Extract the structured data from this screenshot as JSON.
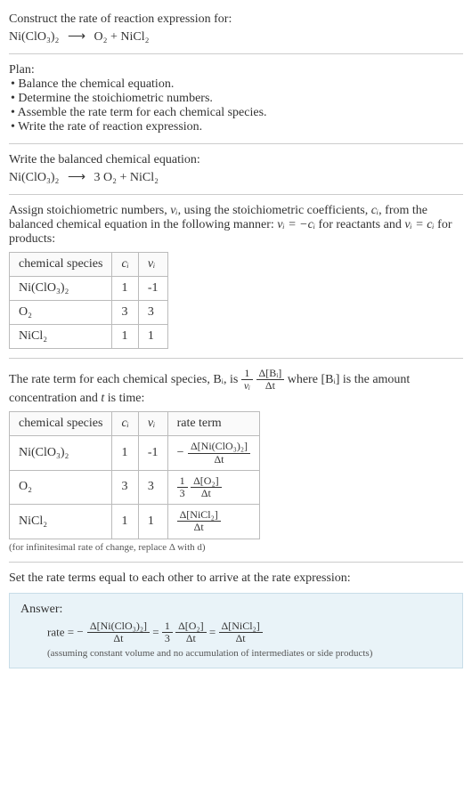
{
  "prompt": {
    "title": "Construct the rate of reaction expression for:",
    "reactant": "Ni(ClO₃)₂",
    "arrow": "⟶",
    "products": "O₂ + NiCl₂"
  },
  "plan": {
    "title": "Plan:",
    "items": [
      "Balance the chemical equation.",
      "Determine the stoichiometric numbers.",
      "Assemble the rate term for each chemical species.",
      "Write the rate of reaction expression."
    ]
  },
  "balance": {
    "title": "Write the balanced chemical equation:",
    "reactant": "Ni(ClO₃)₂",
    "arrow": "⟶",
    "products": "3 O₂ + NiCl₂"
  },
  "stoich": {
    "title_part1": "Assign stoichiometric numbers, ",
    "var1": "νᵢ",
    "title_part2": ", using the stoichiometric coefficients, ",
    "var2": "cᵢ",
    "title_part3": ", from the balanced chemical equation in the following manner: ",
    "rule1": "νᵢ = −cᵢ",
    "title_part4": " for reactants and ",
    "rule2": "νᵢ = cᵢ",
    "title_part5": " for products:",
    "headers": {
      "species": "chemical species",
      "c": "cᵢ",
      "v": "νᵢ"
    },
    "rows": [
      {
        "species": "Ni(ClO₃)₂",
        "c": "1",
        "v": "-1"
      },
      {
        "species": "O₂",
        "c": "3",
        "v": "3"
      },
      {
        "species": "NiCl₂",
        "c": "1",
        "v": "1"
      }
    ]
  },
  "rateterm": {
    "intro1": "The rate term for each chemical species, ",
    "B": "Bᵢ",
    "intro2": ", is ",
    "one": "1",
    "vi": "νᵢ",
    "dB": "Δ[Bᵢ]",
    "dt": "Δt",
    "intro3": " where ",
    "conc": "[Bᵢ]",
    "intro4": " is the amount concentration and ",
    "t": "t",
    "intro5": " is time:",
    "headers": {
      "species": "chemical species",
      "c": "cᵢ",
      "v": "νᵢ",
      "rate": "rate term"
    },
    "rows": [
      {
        "species": "Ni(ClO₃)₂",
        "c": "1",
        "v": "-1"
      },
      {
        "species": "O₂",
        "c": "3",
        "v": "3"
      },
      {
        "species": "NiCl₂",
        "c": "1",
        "v": "1"
      }
    ],
    "dNi": "Δ[Ni(ClO₃)₂]",
    "dO2": "Δ[O₂]",
    "dNiCl2": "Δ[NiCl₂]",
    "three": "3",
    "note": "(for infinitesimal rate of change, replace Δ with d)"
  },
  "final": {
    "title": "Set the rate terms equal to each other to arrive at the rate expression:",
    "answer_label": "Answer:",
    "rate": "rate",
    "eq": "=",
    "minus": "−",
    "one": "1",
    "three": "3",
    "dNi": "Δ[Ni(ClO₃)₂]",
    "dO2": "Δ[O₂]",
    "dNiCl2": "Δ[NiCl₂]",
    "dt": "Δt",
    "note": "(assuming constant volume and no accumulation of intermediates or side products)"
  }
}
